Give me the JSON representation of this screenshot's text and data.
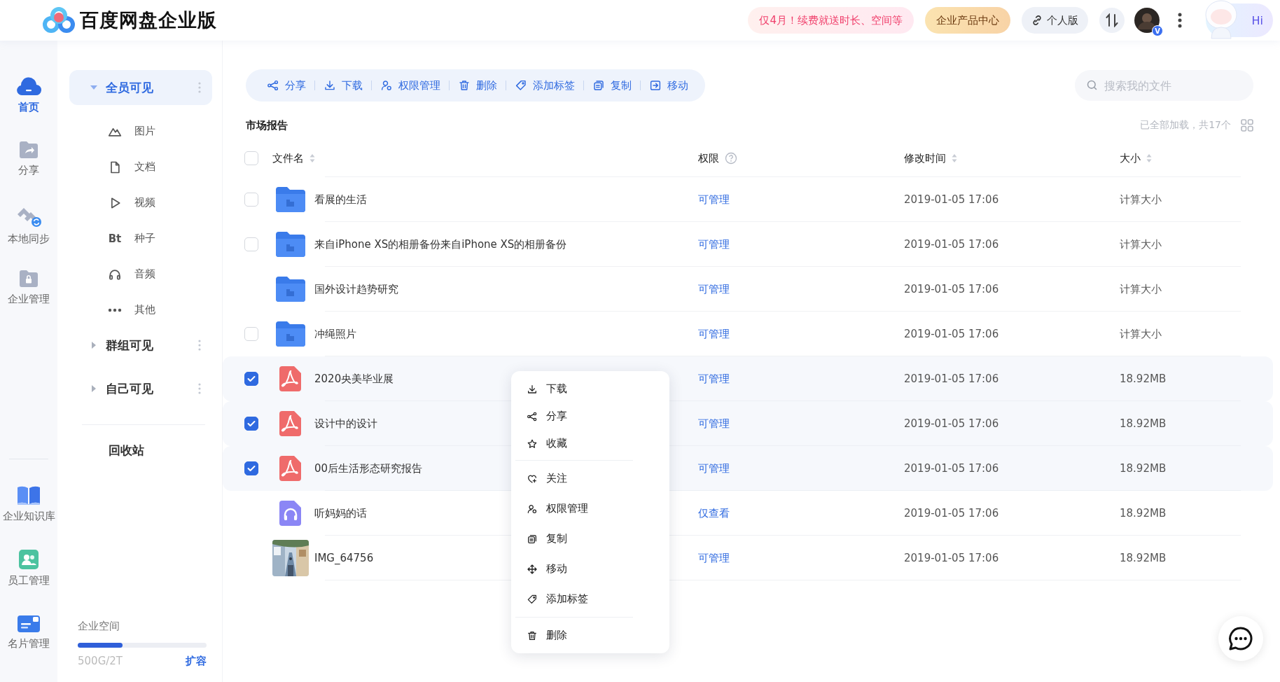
{
  "header": {
    "title": "百度网盘企业版",
    "promo": "仅4月！续费就送时长、空间等",
    "product_center": "企业产品中心",
    "personal": "个人版",
    "avatar_badge": "V",
    "greeting": "Hi"
  },
  "rail": {
    "items": [
      {
        "label": "首页",
        "kind": "home",
        "selected": true
      },
      {
        "label": "分享",
        "kind": "share",
        "selected": false
      },
      {
        "label": "本地同步",
        "kind": "sync",
        "selected": false
      },
      {
        "label": "企业管理",
        "kind": "lock",
        "selected": false
      }
    ],
    "bottom_items": [
      {
        "label": "企业知识库",
        "kind": "book",
        "selected": false
      },
      {
        "label": "员工管理",
        "kind": "staff",
        "selected": false
      },
      {
        "label": "名片管理",
        "kind": "card",
        "selected": false
      }
    ]
  },
  "sidebar": {
    "groups": [
      {
        "label": "全员可见",
        "selected": true,
        "expanded": true,
        "children": [
          {
            "label": "图片",
            "selected": false
          },
          {
            "label": "文档",
            "kind": "doc",
            "selected": false
          },
          {
            "label": "视频",
            "kind": "video",
            "selected": false
          },
          {
            "label": "种子",
            "kind": "torrent",
            "glyph": "Bt",
            "selected": false
          },
          {
            "label": "音频",
            "kind": "audio",
            "selected": false
          },
          {
            "label": "其他",
            "kind": "other",
            "selected": false
          }
        ]
      },
      {
        "label": "群组可见",
        "selected": false,
        "expanded": false
      },
      {
        "label": "自己可见",
        "selected": false,
        "expanded": false
      }
    ],
    "trash": "回收站",
    "storage": {
      "label": "企业空间",
      "level": 0.35,
      "usage": "500G/2T",
      "action": "扩容"
    }
  },
  "toolbar": {
    "actions": [
      {
        "label": "分享",
        "kind": "share"
      },
      {
        "label": "下载",
        "kind": "download"
      },
      {
        "label": "权限管理",
        "kind": "permission"
      },
      {
        "label": "删除",
        "kind": "delete"
      },
      {
        "label": "添加标签",
        "kind": "tag"
      },
      {
        "label": "复制",
        "kind": "copy"
      },
      {
        "label": "移动",
        "kind": "move"
      }
    ],
    "search_placeholder": "搜索我的文件"
  },
  "folder_title": "市场报告",
  "load_status": "已全部加载，共17个",
  "table": {
    "select_all": false,
    "columns": [
      {
        "label": "文件名",
        "kind": "sort"
      },
      {
        "label": "权限",
        "kind": "help"
      },
      {
        "label": "修改时间",
        "kind": "sort"
      },
      {
        "label": "大小",
        "kind": "sort"
      }
    ],
    "rows": [
      {
        "name": "看展的生活",
        "kind": "folder",
        "permission": "可管理",
        "modified": "2019-01-05 17:06",
        "size": "计算大小",
        "checked": false
      },
      {
        "name": "来自iPhone XS的相册备份来自iPhone XS的相册备份",
        "kind": "folder",
        "permission": "可管理",
        "modified": "2019-01-05 17:06",
        "size": "计算大小",
        "checked": false
      },
      {
        "name": "国外设计趋势研究",
        "kind": "folder",
        "permission": "可管理",
        "modified": "2019-01-05 17:06",
        "size": "计算大小"
      },
      {
        "name": "冲绳照片",
        "kind": "folder",
        "permission": "可管理",
        "modified": "2019-01-05 17:06",
        "size": "计算大小",
        "checked": false
      },
      {
        "name": "2020央美毕业展",
        "kind": "pdf",
        "permission": "可管理",
        "modified": "2019-01-05 17:06",
        "size": "18.92MB",
        "checked": true
      },
      {
        "name": "设计中的设计",
        "kind": "pdf",
        "permission": "可管理",
        "modified": "2019-01-05 17:06",
        "size": "18.92MB",
        "checked": true
      },
      {
        "name": "00后生活形态研究报告",
        "kind": "pdf",
        "permission": "可管理",
        "modified": "2019-01-05 17:06",
        "size": "18.92MB",
        "checked": true
      },
      {
        "name": "听妈妈的话",
        "kind": "audio",
        "permission": "仅查看",
        "modified": "2019-01-05 17:06",
        "size": "18.92MB"
      },
      {
        "name": "IMG_64756",
        "permission": "可管理",
        "modified": "2019-01-05 17:06",
        "size": "18.92MB"
      }
    ]
  },
  "context_menu": {
    "items": [
      {
        "label": "下载",
        "kind": "download"
      },
      {
        "label": "分享",
        "kind": "share"
      },
      {
        "label": "收藏",
        "kind": "star"
      },
      {
        "kind": "divider"
      },
      {
        "label": "关注",
        "kind": "follow"
      },
      {
        "label": "权限管理",
        "kind": "permission"
      },
      {
        "label": "复制",
        "kind": "copy"
      },
      {
        "label": "移动",
        "kind": "move"
      },
      {
        "label": "添加标签",
        "kind": "tag"
      },
      {
        "kind": "divider"
      },
      {
        "label": "删除",
        "kind": "delete"
      }
    ]
  }
}
